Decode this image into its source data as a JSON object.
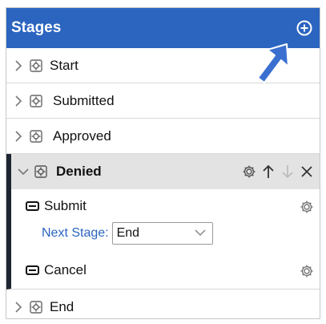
{
  "header": {
    "title": "Stages"
  },
  "stages_before": [
    {
      "label": "Start"
    },
    {
      "label": "Submitted"
    },
    {
      "label": "Approved"
    }
  ],
  "expanded": {
    "label": "Denied",
    "actions": [
      {
        "label": "Submit",
        "next_stage_label": "Next Stage:",
        "next_stage_value": "End"
      },
      {
        "label": "Cancel"
      }
    ]
  },
  "stages_after": [
    {
      "label": "End"
    }
  ],
  "colors": {
    "header": "#2b65c0",
    "accent_arrow": "#3a6fd0",
    "selected_bar": "#1f2633"
  }
}
